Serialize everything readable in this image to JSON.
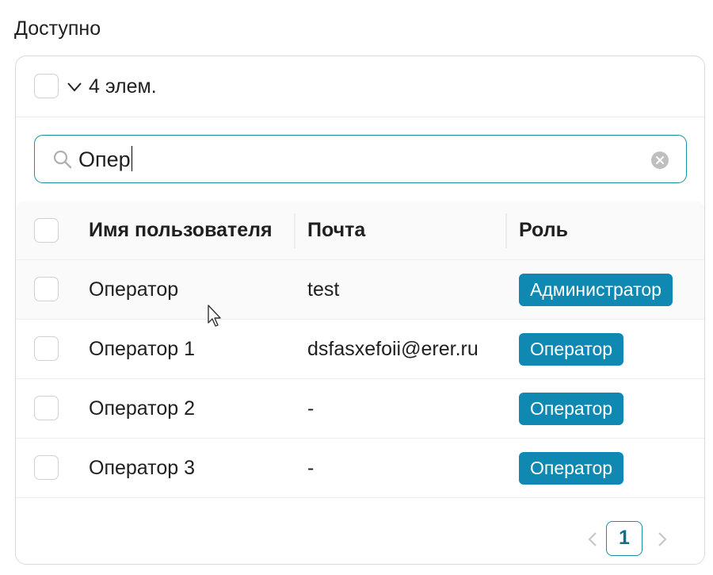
{
  "section_title": "Доступно",
  "header": {
    "count_label": "4 элем."
  },
  "search": {
    "value": "Опер"
  },
  "table": {
    "columns": [
      "Имя пользователя",
      "Почта",
      "Роль"
    ],
    "rows": [
      {
        "name": "Оператор",
        "email": "test",
        "role": "Администратор"
      },
      {
        "name": "Оператор 1",
        "email": "dsfasxefoii@erer.ru",
        "role": "Оператор"
      },
      {
        "name": "Оператор 2",
        "email": "-",
        "role": "Оператор"
      },
      {
        "name": "Оператор 3",
        "email": "-",
        "role": "Оператор"
      }
    ]
  },
  "pagination": {
    "current_page": "1"
  },
  "colors": {
    "accent": "#1a8fa8",
    "tag_bg": "#0f89b2"
  }
}
